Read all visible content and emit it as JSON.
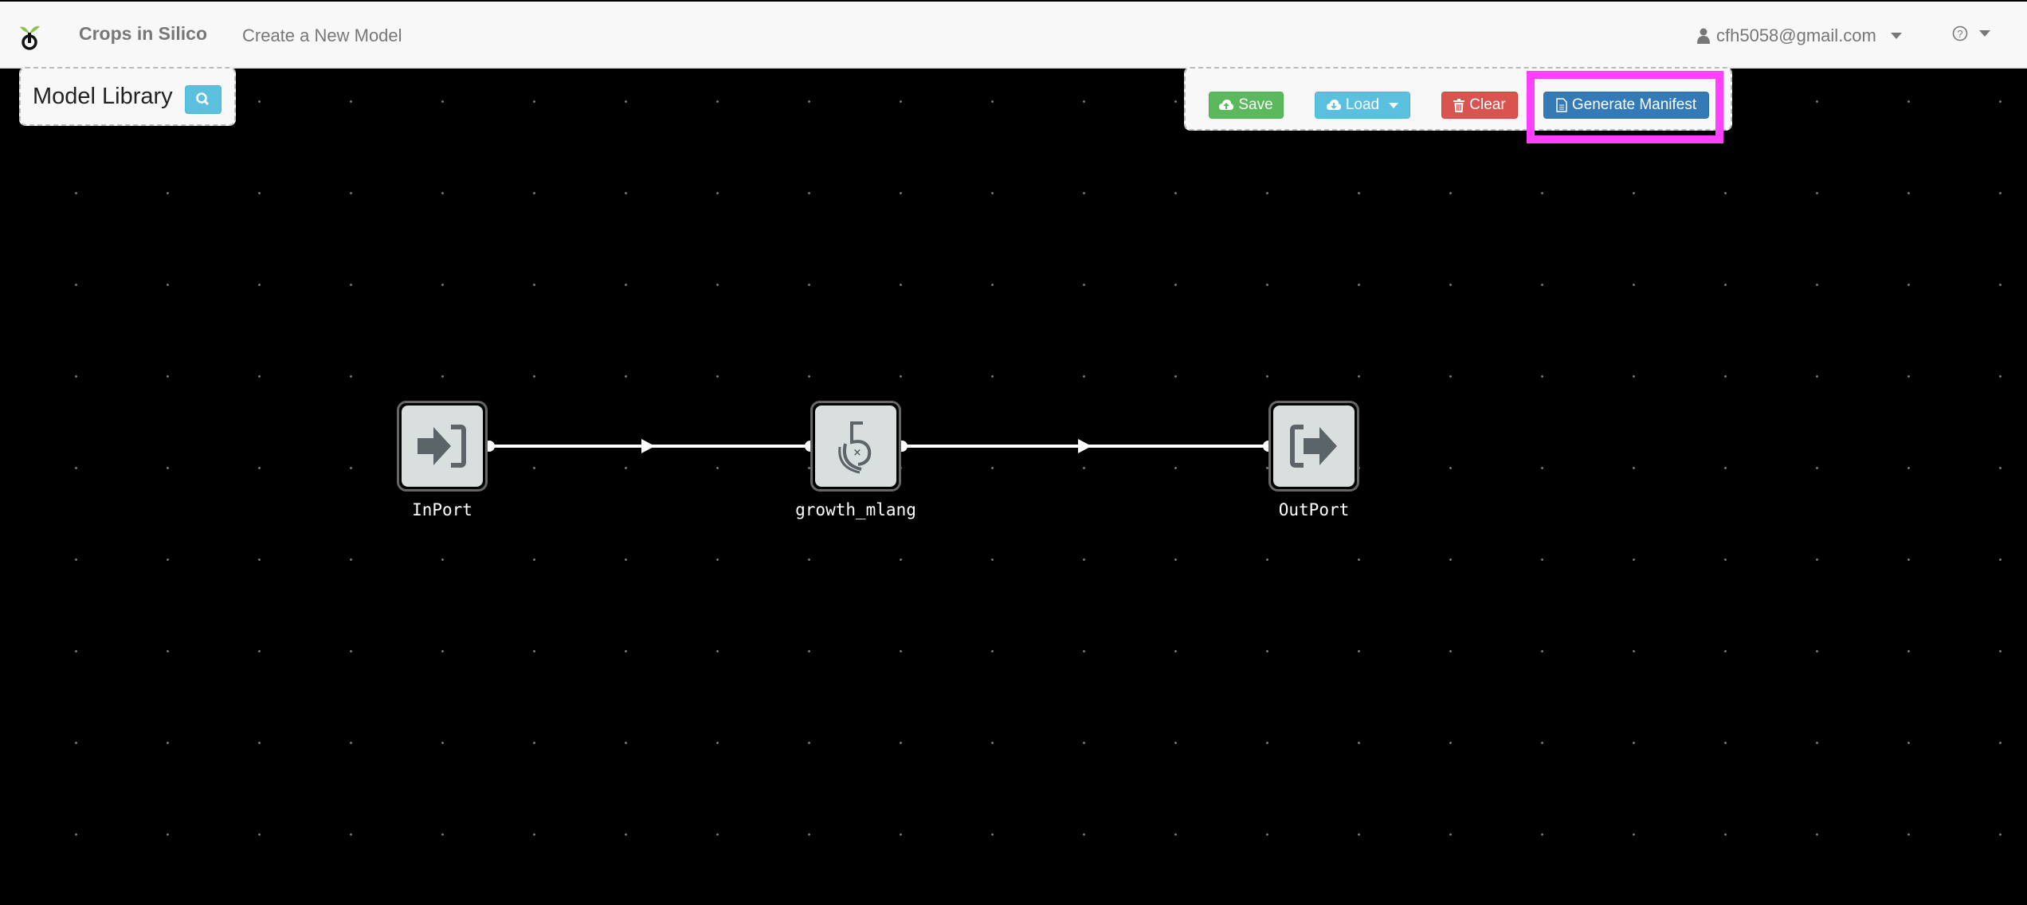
{
  "navbar": {
    "brand": "Crops in Silico",
    "create_link": "Create a New Model",
    "user_email": "cfh5058@gmail.com",
    "help_icon": "question-circle-icon"
  },
  "model_library": {
    "title": "Model Library",
    "search_icon": "search-icon"
  },
  "toolbar": {
    "save_label": "Save",
    "load_label": "Load",
    "clear_label": "Clear",
    "generate_label": "Generate Manifest"
  },
  "graph": {
    "nodes": [
      {
        "label": "InPort",
        "icon": "sign-in-icon"
      },
      {
        "label": "growth_mlang",
        "icon": "model-5-icon"
      },
      {
        "label": "OutPort",
        "icon": "sign-out-icon"
      }
    ],
    "edges": [
      {
        "from": "InPort",
        "to": "growth_mlang"
      },
      {
        "from": "growth_mlang",
        "to": "OutPort"
      }
    ]
  },
  "colors": {
    "save": "#5cb85c",
    "load": "#5bc0de",
    "clear": "#d9534f",
    "generate": "#337ab7",
    "highlight": "#ff40ff",
    "canvas": "#000000"
  }
}
